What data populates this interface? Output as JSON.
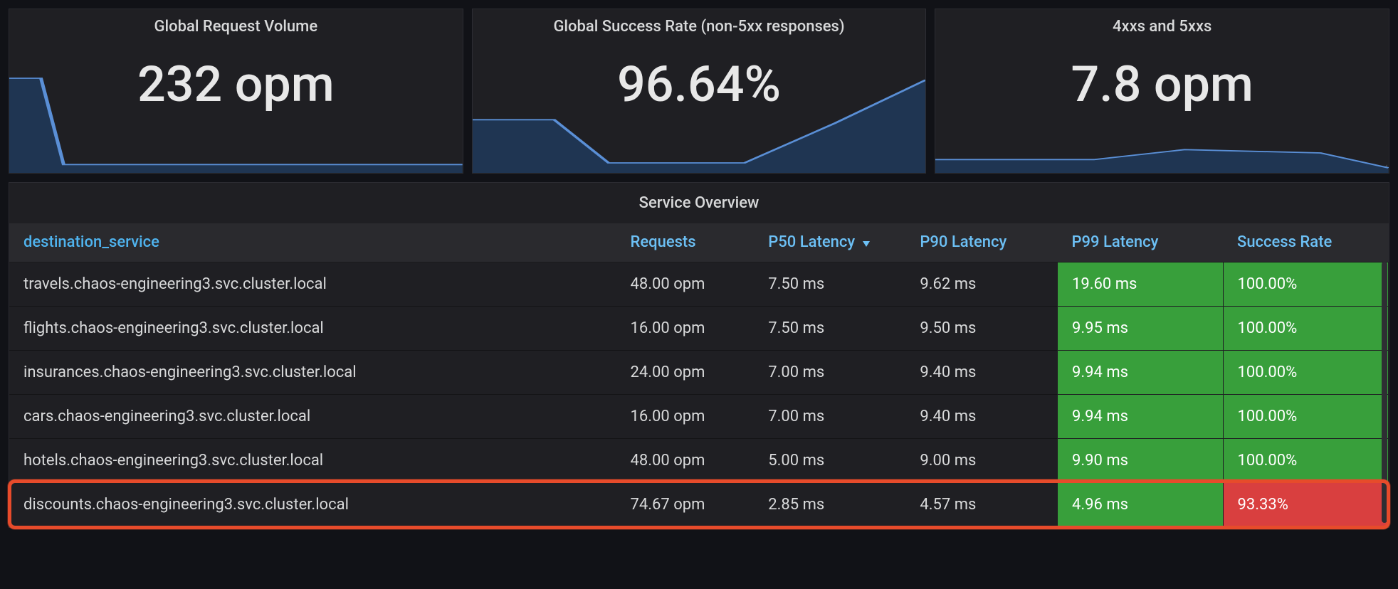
{
  "stats": [
    {
      "title": "Global Request Volume",
      "value": "232 opm"
    },
    {
      "title": "Global Success Rate (non-5xx responses)",
      "value": "96.64%"
    },
    {
      "title": "4xxs and 5xxs",
      "value": "7.8 opm"
    }
  ],
  "chart_data": [
    {
      "type": "area",
      "title": "Global Request Volume",
      "x": [
        0,
        0.07,
        0.12,
        1.0
      ],
      "values": [
        0.95,
        0.95,
        0.05,
        0.05
      ],
      "ylim": [
        0,
        1
      ],
      "ylabel": "",
      "xlabel": ""
    },
    {
      "type": "area",
      "title": "Global Success Rate (non-5xx responses)",
      "x": [
        0,
        0.18,
        0.3,
        0.6,
        0.8,
        1.0
      ],
      "values": [
        0.55,
        0.55,
        0.1,
        0.1,
        0.5,
        1.0
      ],
      "ylim": [
        0,
        1
      ],
      "ylabel": "",
      "xlabel": ""
    },
    {
      "type": "area",
      "title": "4xxs and 5xxs",
      "x": [
        0,
        0.35,
        0.55,
        0.85,
        1.0
      ],
      "values": [
        0.12,
        0.12,
        0.22,
        0.18,
        0.05
      ],
      "ylim": [
        0,
        1
      ],
      "ylabel": "",
      "xlabel": ""
    }
  ],
  "table": {
    "title": "Service Overview",
    "columns": [
      {
        "key": "destination_service",
        "label": "destination_service"
      },
      {
        "key": "requests",
        "label": "Requests"
      },
      {
        "key": "p50",
        "label": "P50 Latency",
        "sorted": "desc"
      },
      {
        "key": "p90",
        "label": "P90 Latency"
      },
      {
        "key": "p99",
        "label": "P99 Latency"
      },
      {
        "key": "success",
        "label": "Success Rate"
      }
    ],
    "rows": [
      {
        "destination_service": "travels.chaos-engineering3.svc.cluster.local",
        "requests": "48.00 opm",
        "p50": "7.50 ms",
        "p90": "9.62 ms",
        "p99": {
          "value": "19.60 ms",
          "status": "green"
        },
        "success": {
          "value": "100.00%",
          "status": "green"
        }
      },
      {
        "destination_service": "flights.chaos-engineering3.svc.cluster.local",
        "requests": "16.00 opm",
        "p50": "7.50 ms",
        "p90": "9.50 ms",
        "p99": {
          "value": "9.95 ms",
          "status": "green"
        },
        "success": {
          "value": "100.00%",
          "status": "green"
        }
      },
      {
        "destination_service": "insurances.chaos-engineering3.svc.cluster.local",
        "requests": "24.00 opm",
        "p50": "7.00 ms",
        "p90": "9.40 ms",
        "p99": {
          "value": "9.94 ms",
          "status": "green"
        },
        "success": {
          "value": "100.00%",
          "status": "green"
        }
      },
      {
        "destination_service": "cars.chaos-engineering3.svc.cluster.local",
        "requests": "16.00 opm",
        "p50": "7.00 ms",
        "p90": "9.40 ms",
        "p99": {
          "value": "9.94 ms",
          "status": "green"
        },
        "success": {
          "value": "100.00%",
          "status": "green"
        }
      },
      {
        "destination_service": "hotels.chaos-engineering3.svc.cluster.local",
        "requests": "48.00 opm",
        "p50": "5.00 ms",
        "p90": "9.00 ms",
        "p99": {
          "value": "9.90 ms",
          "status": "green"
        },
        "success": {
          "value": "100.00%",
          "status": "green"
        }
      },
      {
        "destination_service": "discounts.chaos-engineering3.svc.cluster.local",
        "requests": "74.67 opm",
        "p50": "2.85 ms",
        "p90": "4.57 ms",
        "p99": {
          "value": "4.96 ms",
          "status": "green"
        },
        "success": {
          "value": "93.33%",
          "status": "red"
        },
        "highlighted": true
      }
    ]
  },
  "colors": {
    "green": "#389f3b",
    "red": "#d93f3f",
    "link": "#6cc0f5",
    "highlight_border": "#e74b2b"
  }
}
